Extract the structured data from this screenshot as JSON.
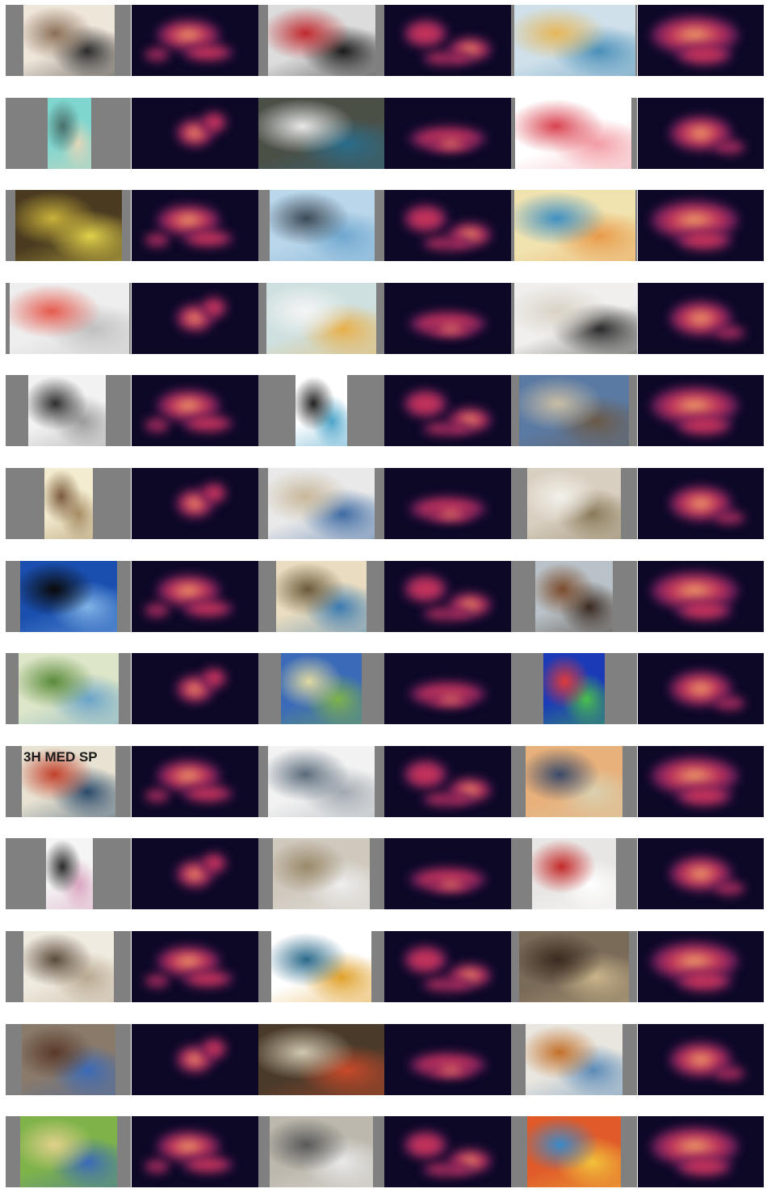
{
  "figure": {
    "rows": [
      {
        "pairs": [
          {
            "image": "framed-abstract-artwork-on-shelf",
            "image_text": "",
            "saliency": "saliency-heatmap"
          },
          {
            "image": "hanging-balloon-installation",
            "image_text": "",
            "saliency": "saliency-heatmap"
          },
          {
            "image": "world-map-on-wall",
            "image_text": "",
            "saliency": "saliency-heatmap"
          }
        ]
      },
      {
        "pairs": [
          {
            "image": "surreal-illustration-on-teal",
            "image_text": "",
            "saliency": "saliency-heatmap"
          },
          {
            "image": "indoor-cloud-installation",
            "image_text": "",
            "saliency": "saliency-heatmap"
          },
          {
            "image": "red-blossom-painting-with-window",
            "image_text": "",
            "saliency": "saliency-heatmap"
          }
        ]
      },
      {
        "pairs": [
          {
            "image": "lemons-on-gallery-floor",
            "image_text": "",
            "saliency": "saliency-heatmap"
          },
          {
            "image": "black-bird-on-blue-splashes",
            "image_text": "",
            "saliency": "saliency-heatmap"
          },
          {
            "image": "blue-fish-print",
            "image_text": "",
            "saliency": "saliency-heatmap"
          }
        ]
      },
      {
        "pairs": [
          {
            "image": "white-gallery-with-red-artwork",
            "image_text": "",
            "saliency": "saliency-heatmap"
          },
          {
            "image": "light-bulb-egg",
            "image_text": "",
            "saliency": "saliency-heatmap"
          },
          {
            "image": "modern-living-room",
            "image_text": "",
            "saliency": "saliency-heatmap"
          }
        ]
      },
      {
        "pairs": [
          {
            "image": "microphone-stand-installation",
            "image_text": "",
            "saliency": "saliency-heatmap"
          },
          {
            "image": "minimal-hanging-objects",
            "image_text": "",
            "saliency": "saliency-heatmap"
          },
          {
            "image": "driftwood-on-beach",
            "image_text": "",
            "saliency": "saliency-heatmap"
          }
        ]
      },
      {
        "pairs": [
          {
            "image": "stone-relief-fragment",
            "image_text": "",
            "saliency": "saliency-heatmap"
          },
          {
            "image": "pile-of-rocks-installation",
            "image_text": "",
            "saliency": "saliency-heatmap"
          },
          {
            "image": "washroom-corner",
            "image_text": "",
            "saliency": "saliency-heatmap"
          }
        ]
      },
      {
        "pairs": [
          {
            "image": "silhouette-landscape-with-moon",
            "image_text": "",
            "saliency": "saliency-heatmap"
          },
          {
            "image": "surreal-bridge-painting",
            "image_text": "",
            "saliency": "saliency-heatmap"
          },
          {
            "image": "figure-with-draped-fabric-sculpture",
            "image_text": "",
            "saliency": "saliency-heatmap"
          }
        ]
      },
      {
        "pairs": [
          {
            "image": "river-landscape-painting",
            "image_text": "",
            "saliency": "saliency-heatmap"
          },
          {
            "image": "modernist-building-by-water",
            "image_text": "",
            "saliency": "saliency-heatmap"
          },
          {
            "image": "cubist-colorful-painting",
            "image_text": "",
            "saliency": "saliency-heatmap"
          }
        ]
      },
      {
        "pairs": [
          {
            "image": "poster-with-lettering",
            "image_text": "3H MED SP",
            "saliency": "saliency-heatmap"
          },
          {
            "image": "vintage-car-in-gallery",
            "image_text": "",
            "saliency": "saliency-heatmap"
          },
          {
            "image": "harbor-sunset-painting",
            "image_text": "",
            "saliency": "saliency-heatmap"
          }
        ]
      },
      {
        "pairs": [
          {
            "image": "room-with-chair-and-appliance",
            "image_text": "",
            "saliency": "saliency-heatmap"
          },
          {
            "image": "empty-gallery-hall",
            "image_text": "",
            "saliency": "saliency-heatmap"
          },
          {
            "image": "white-stakes-with-red-rose",
            "image_text": "",
            "saliency": "saliency-heatmap"
          }
        ]
      },
      {
        "pairs": [
          {
            "image": "wall-mounted-assemblage",
            "image_text": "",
            "saliency": "saliency-heatmap"
          },
          {
            "image": "floral-eye-artwork",
            "image_text": "",
            "saliency": "saliency-heatmap"
          },
          {
            "image": "figures-in-shop-painting",
            "image_text": "",
            "saliency": "saliency-heatmap"
          }
        ]
      },
      {
        "pairs": [
          {
            "image": "animal-sculptures-outdoors",
            "image_text": "",
            "saliency": "saliency-heatmap"
          },
          {
            "image": "birch-forest-with-colors",
            "image_text": "",
            "saliency": "saliency-heatmap"
          },
          {
            "image": "chickens-still-life",
            "image_text": "",
            "saliency": "saliency-heatmap"
          }
        ]
      },
      {
        "pairs": [
          {
            "image": "garden-of-earthly-delights",
            "image_text": "",
            "saliency": "saliency-heatmap"
          },
          {
            "image": "tree-sculpture-in-ruin",
            "image_text": "",
            "saliency": "saliency-heatmap"
          },
          {
            "image": "colorful-cubist-figures",
            "image_text": "",
            "saliency": "saliency-heatmap"
          }
        ]
      }
    ]
  },
  "palette": {
    "panel_gray": "#808080",
    "heat_background": "#0d0826",
    "heat_low": "#5a1a5c",
    "heat_mid": "#c2325a",
    "heat_high": "#f6b26a"
  }
}
